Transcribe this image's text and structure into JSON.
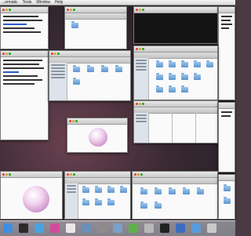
{
  "menubar": {
    "items": [
      "...ormatic",
      "Tools",
      "Window",
      "Help"
    ]
  },
  "dock": {
    "items": [
      {
        "name": "finder",
        "color": "#3f8fe0"
      },
      {
        "name": "dashboard",
        "color": "#2b2b2b"
      },
      {
        "name": "safari",
        "color": "#4aa3e0"
      },
      {
        "name": "itunes",
        "color": "#d24b9a"
      },
      {
        "name": "ical",
        "color": "#e8e8e8"
      },
      {
        "name": "iphoto",
        "color": "#6b8fb8"
      },
      {
        "name": "system-preferences",
        "color": "#8c8c8c"
      },
      {
        "name": "mail",
        "color": "#7aa0c8"
      },
      {
        "name": "app-green",
        "color": "#5db14a"
      },
      {
        "name": "app-x11",
        "color": "#b8b8b8"
      },
      {
        "name": "terminal",
        "color": "#222222"
      },
      {
        "name": "app-blue",
        "color": "#3c6cc0"
      },
      {
        "name": "downloads-stack",
        "color": "#5b9ad8"
      },
      {
        "name": "trash",
        "color": "#c9c9c9"
      }
    ]
  }
}
